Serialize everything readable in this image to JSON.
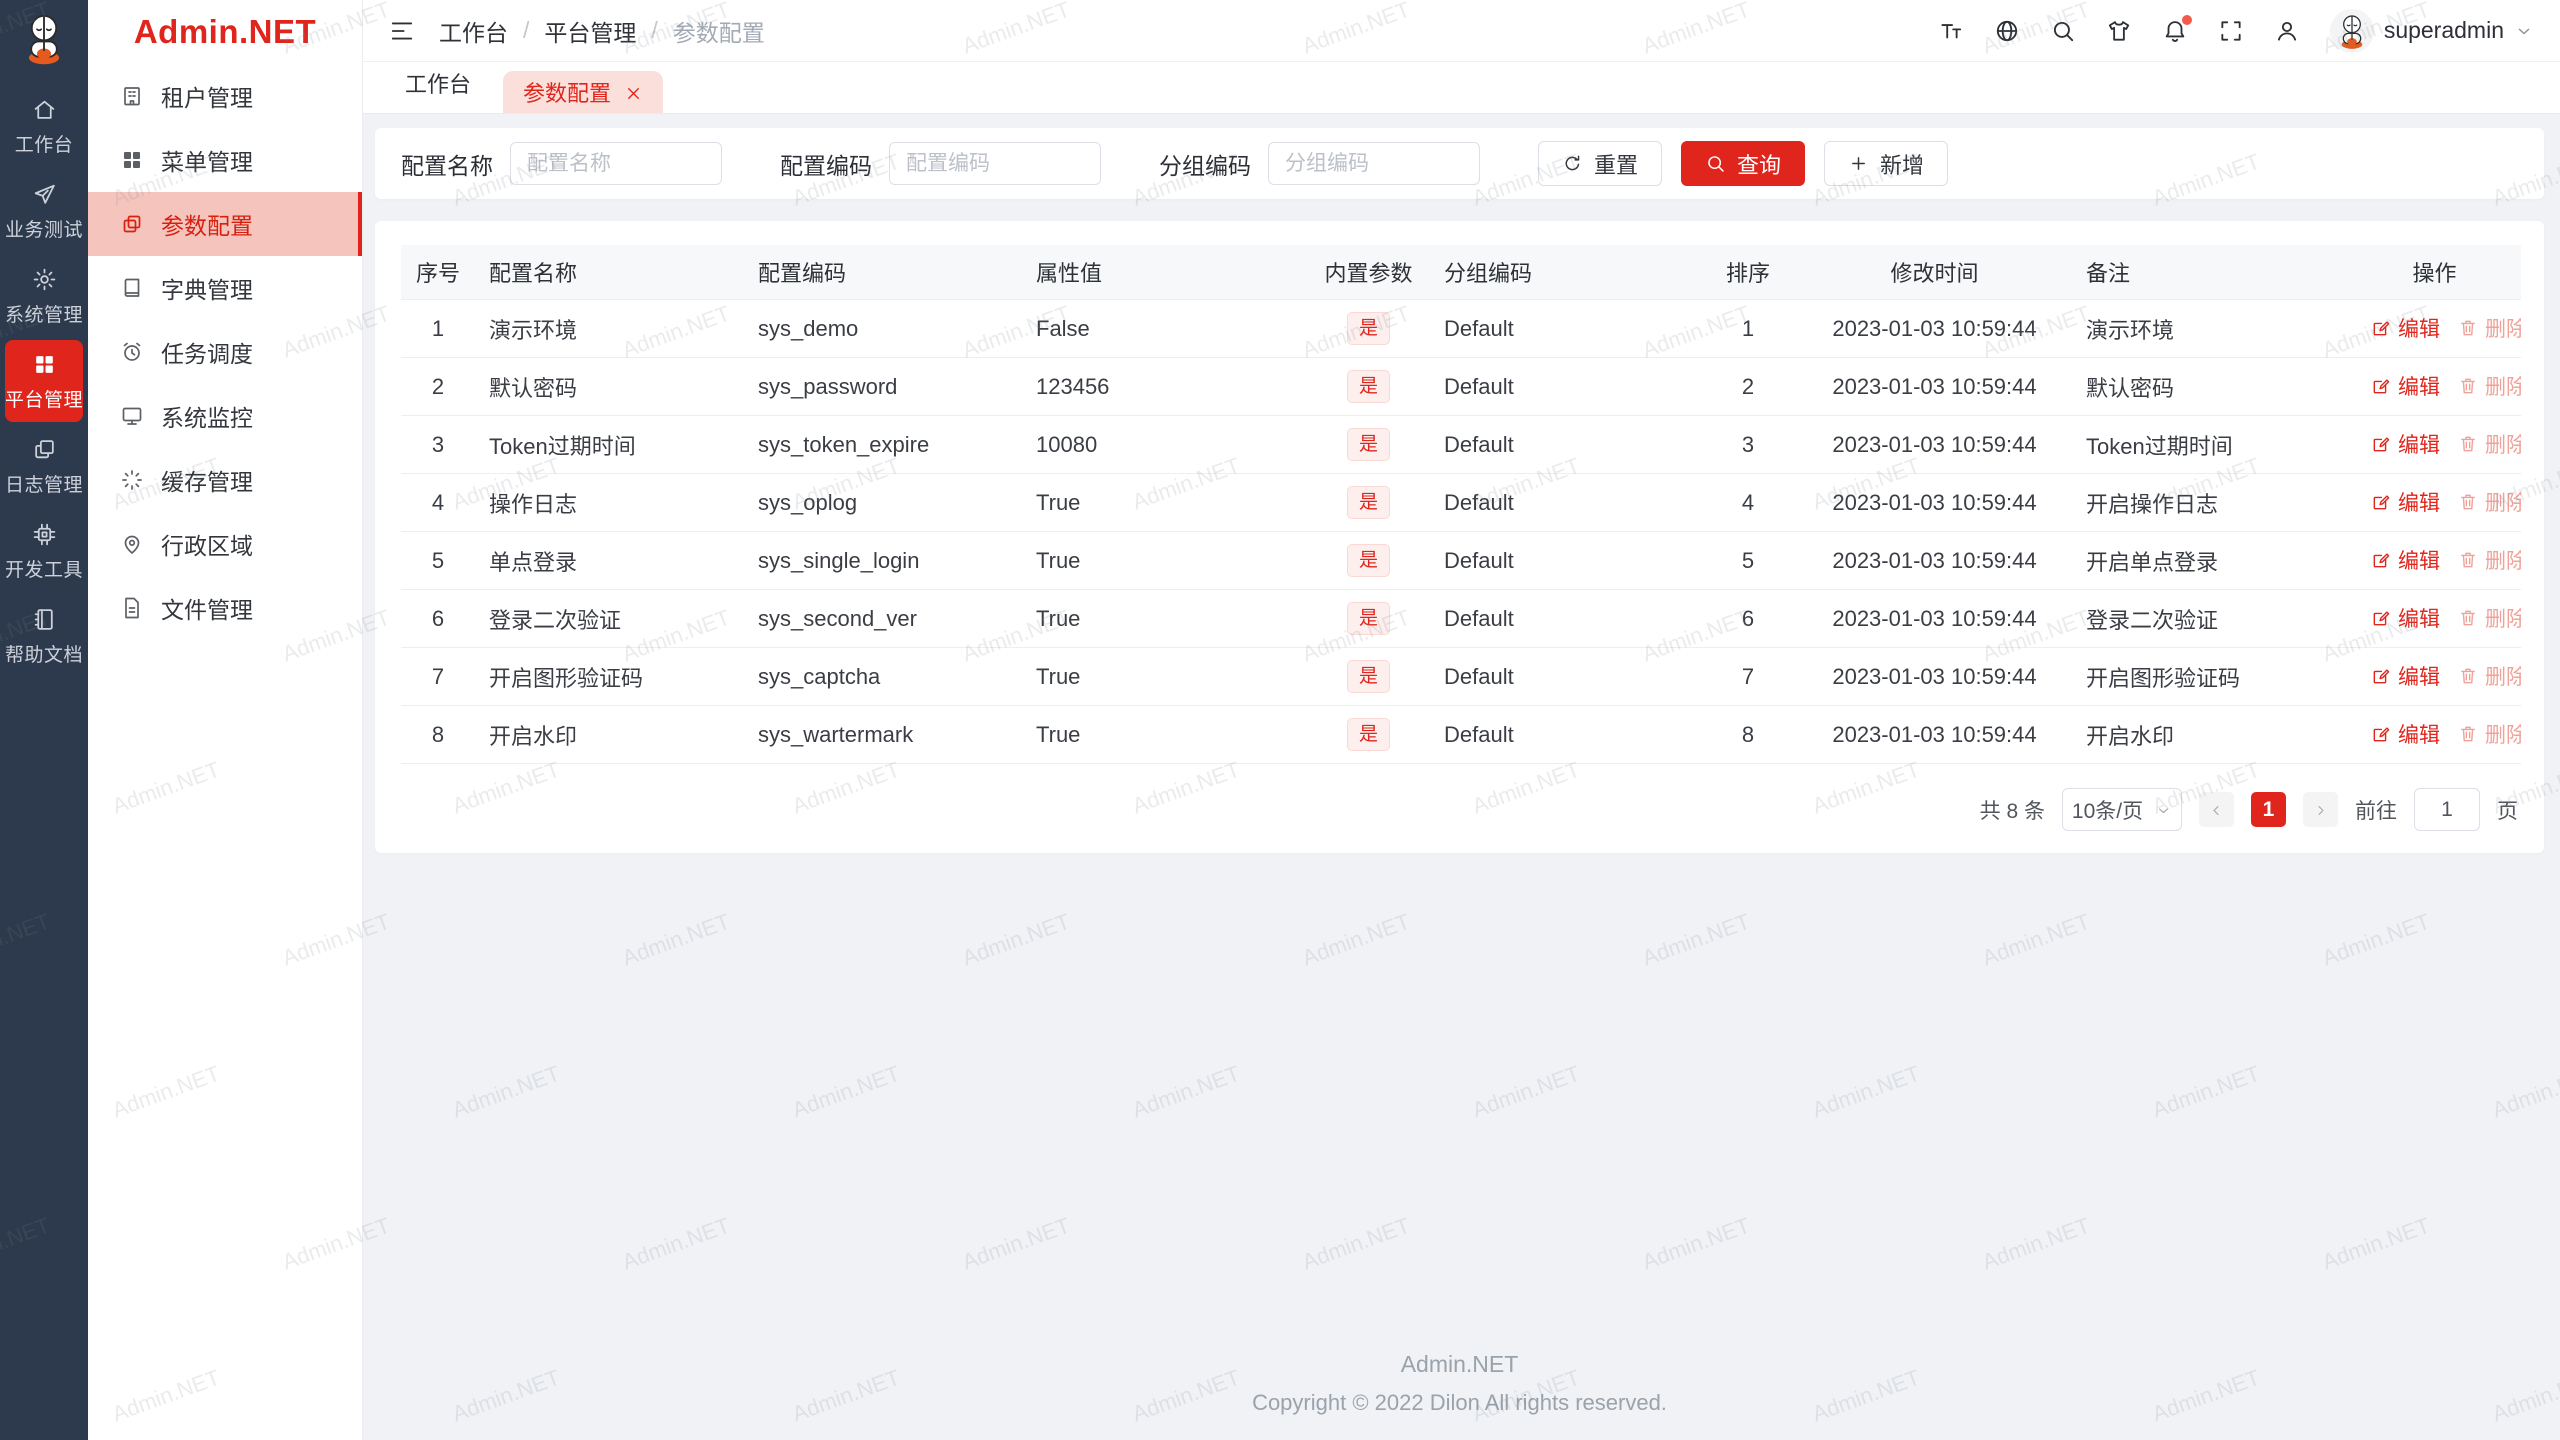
{
  "brand": {
    "logo_text": "Admin.NET",
    "brand_red": "#e0251c",
    "rail_bg": "#2d3a4d",
    "active_menu_bg": "#f5c4bd"
  },
  "rail": {
    "items": [
      {
        "label": "工作台",
        "icon": "home-icon",
        "active": false
      },
      {
        "label": "业务测试",
        "icon": "send-icon",
        "active": false
      },
      {
        "label": "系统管理",
        "icon": "gear-icon",
        "active": false
      },
      {
        "label": "平台管理",
        "icon": "grid-icon",
        "active": true
      },
      {
        "label": "日志管理",
        "icon": "logs-icon",
        "active": false
      },
      {
        "label": "开发工具",
        "icon": "cpu-icon",
        "active": false
      },
      {
        "label": "帮助文档",
        "icon": "docs-icon",
        "active": false
      }
    ]
  },
  "sidebar": {
    "items": [
      {
        "label": "租户管理",
        "icon": "tenant-icon",
        "active": false
      },
      {
        "label": "菜单管理",
        "icon": "menu-icon",
        "active": false
      },
      {
        "label": "参数配置",
        "icon": "config-icon",
        "active": true
      },
      {
        "label": "字典管理",
        "icon": "dict-icon",
        "active": false
      },
      {
        "label": "任务调度",
        "icon": "schedule-icon",
        "active": false
      },
      {
        "label": "系统监控",
        "icon": "monitor-icon",
        "active": false
      },
      {
        "label": "缓存管理",
        "icon": "cache-icon",
        "active": false
      },
      {
        "label": "行政区域",
        "icon": "region-icon",
        "active": false
      },
      {
        "label": "文件管理",
        "icon": "file-icon",
        "active": false
      }
    ]
  },
  "header": {
    "breadcrumb": [
      "工作台",
      "平台管理",
      "参数配置"
    ],
    "separator": "/",
    "username": "superadmin"
  },
  "tabs": [
    {
      "label": "工作台",
      "active": false
    },
    {
      "label": "参数配置",
      "active": true
    }
  ],
  "search": {
    "fields": [
      {
        "label": "配置名称",
        "placeholder": "配置名称",
        "value": ""
      },
      {
        "label": "配置编码",
        "placeholder": "配置编码",
        "value": ""
      },
      {
        "label": "分组编码",
        "placeholder": "分组编码",
        "value": ""
      }
    ],
    "reset_label": "重置",
    "query_label": "查询",
    "add_label": "新增"
  },
  "table": {
    "columns": [
      "序号",
      "配置名称",
      "配置编码",
      "属性值",
      "内置参数",
      "分组编码",
      "排序",
      "修改时间",
      "备注",
      "操作"
    ],
    "edit_label": "编辑",
    "delete_label": "删除",
    "rows": [
      {
        "index": "1",
        "name": "演示环境",
        "code": "sys_demo",
        "value": "False",
        "builtin": "是",
        "group": "Default",
        "sort": "1",
        "time": "2023-01-03 10:59:44",
        "remark": "演示环境"
      },
      {
        "index": "2",
        "name": "默认密码",
        "code": "sys_password",
        "value": "123456",
        "builtin": "是",
        "group": "Default",
        "sort": "2",
        "time": "2023-01-03 10:59:44",
        "remark": "默认密码"
      },
      {
        "index": "3",
        "name": "Token过期时间",
        "code": "sys_token_expire",
        "value": "10080",
        "builtin": "是",
        "group": "Default",
        "sort": "3",
        "time": "2023-01-03 10:59:44",
        "remark": "Token过期时间"
      },
      {
        "index": "4",
        "name": "操作日志",
        "code": "sys_oplog",
        "value": "True",
        "builtin": "是",
        "group": "Default",
        "sort": "4",
        "time": "2023-01-03 10:59:44",
        "remark": "开启操作日志"
      },
      {
        "index": "5",
        "name": "单点登录",
        "code": "sys_single_login",
        "value": "True",
        "builtin": "是",
        "group": "Default",
        "sort": "5",
        "time": "2023-01-03 10:59:44",
        "remark": "开启单点登录"
      },
      {
        "index": "6",
        "name": "登录二次验证",
        "code": "sys_second_ver",
        "value": "True",
        "builtin": "是",
        "group": "Default",
        "sort": "6",
        "time": "2023-01-03 10:59:44",
        "remark": "登录二次验证"
      },
      {
        "index": "7",
        "name": "开启图形验证码",
        "code": "sys_captcha",
        "value": "True",
        "builtin": "是",
        "group": "Default",
        "sort": "7",
        "time": "2023-01-03 10:59:44",
        "remark": "开启图形验证码"
      },
      {
        "index": "8",
        "name": "开启水印",
        "code": "sys_wartermark",
        "value": "True",
        "builtin": "是",
        "group": "Default",
        "sort": "8",
        "time": "2023-01-03 10:59:44",
        "remark": "开启水印"
      }
    ]
  },
  "pagination": {
    "total_label": "共 8 条",
    "page_size": "10条/页",
    "current_page": "1",
    "goto_label": "前往",
    "goto_value": "1",
    "page_label": "页"
  },
  "footer": {
    "title": "Admin.NET",
    "copyright": "Copyright © 2022 Dilon All rights reserved."
  },
  "watermark": {
    "text": "Admin.NET"
  }
}
